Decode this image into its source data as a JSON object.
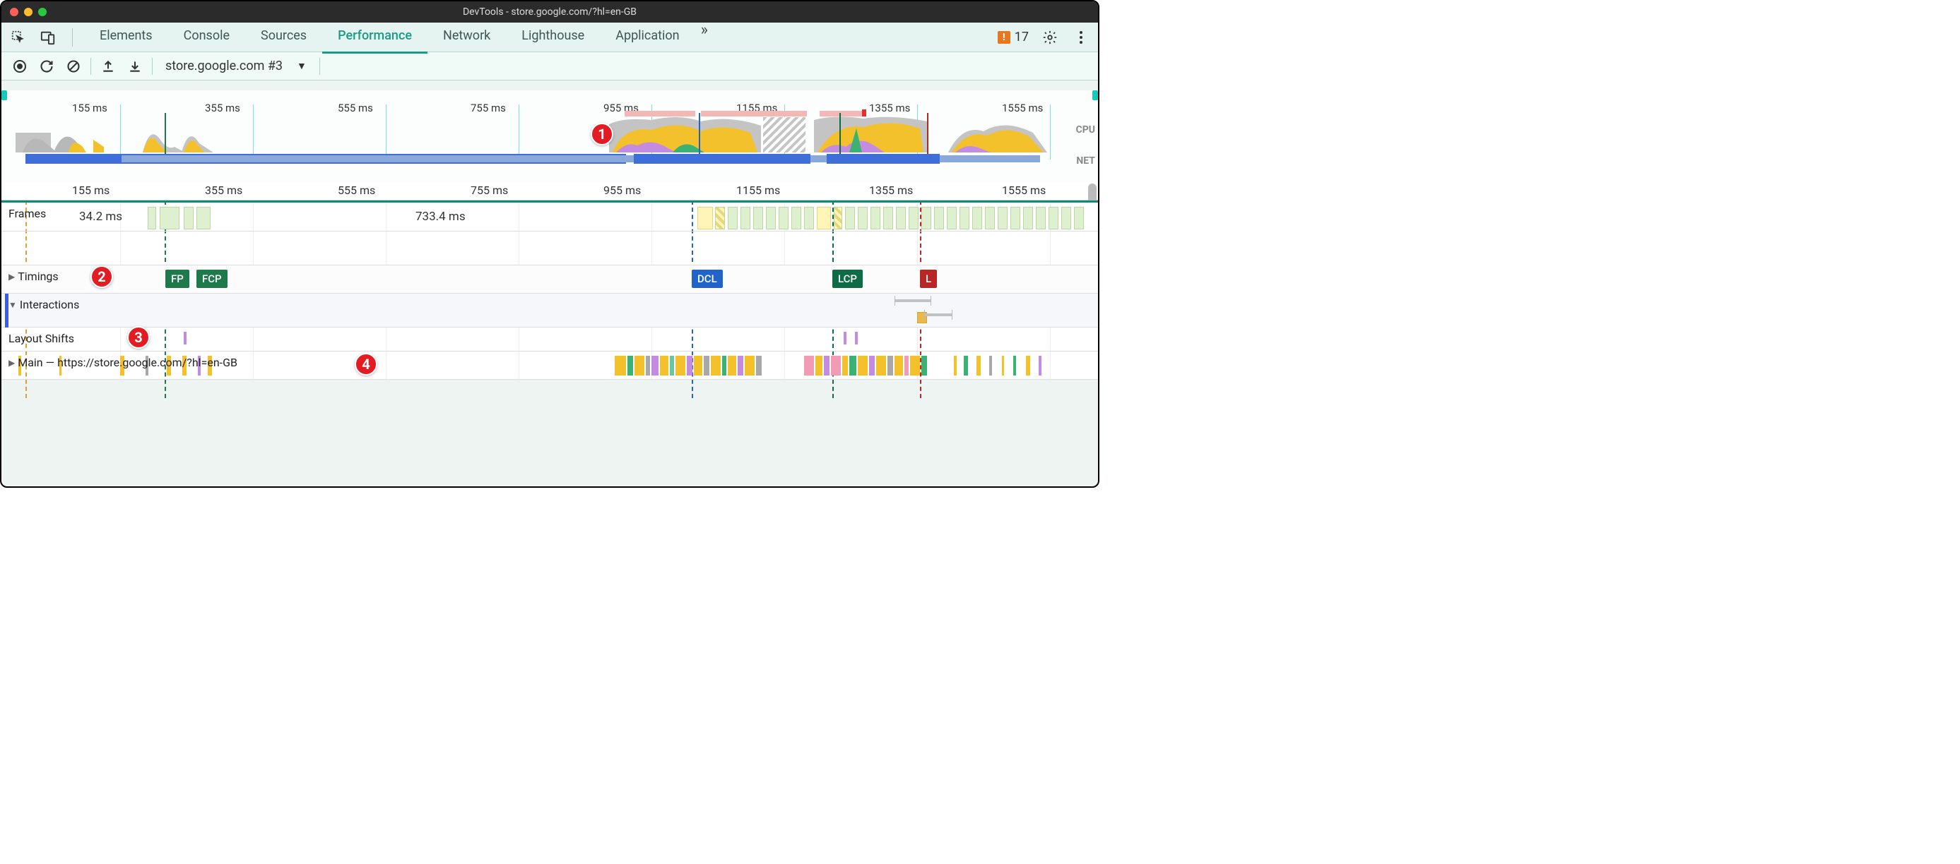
{
  "window": {
    "title": "DevTools - store.google.com/?hl=en-GB"
  },
  "tabs": {
    "items": [
      "Elements",
      "Console",
      "Sources",
      "Performance",
      "Network",
      "Lighthouse",
      "Application"
    ],
    "active_index": 3,
    "more": "»"
  },
  "issues": {
    "count": "17"
  },
  "toolbar": {
    "recording_label": "store.google.com #3"
  },
  "overview": {
    "ticks": [
      "155 ms",
      "355 ms",
      "555 ms",
      "755 ms",
      "955 ms",
      "1155 ms",
      "1355 ms",
      "1555 ms"
    ],
    "cpu_label": "CPU",
    "net_label": "NET"
  },
  "ruler": {
    "ticks": [
      "155 ms",
      "355 ms",
      "555 ms",
      "755 ms",
      "955 ms",
      "1155 ms",
      "1355 ms",
      "1555 ms"
    ]
  },
  "tracks": {
    "frames": {
      "label": "Frames",
      "ms_a": "34.2 ms",
      "ms_b": "733.4 ms"
    },
    "timings": {
      "label": "Timings"
    },
    "interactions": {
      "label": "Interactions"
    },
    "layout_shifts": {
      "label": "Layout Shifts"
    },
    "main": {
      "label": "Main — https://store.google.com/?hl=en-GB"
    }
  },
  "timing_pills": {
    "fp": "FP",
    "fcp": "FCP",
    "dcl": "DCL",
    "lcp": "LCP",
    "l": "L"
  },
  "annotations": {
    "b1": "1",
    "b2": "2",
    "b3": "3",
    "b4": "4"
  }
}
